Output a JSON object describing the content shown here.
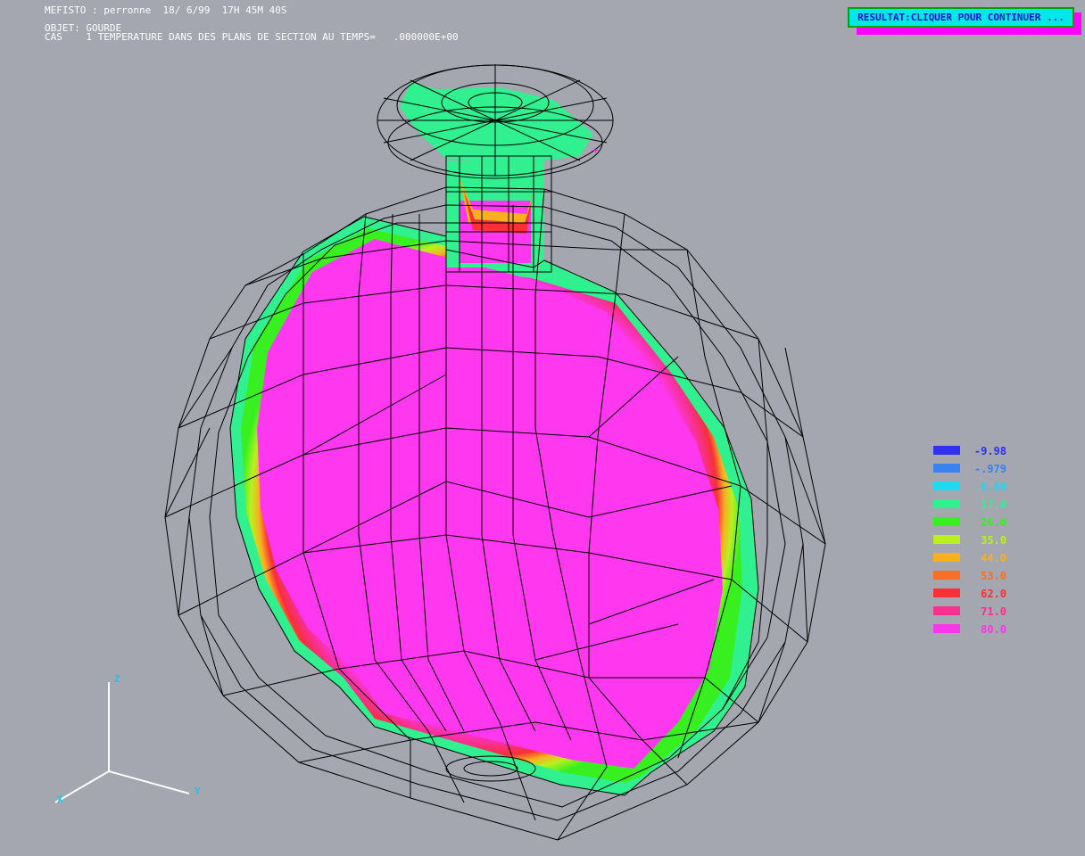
{
  "header": {
    "line1": "MEFISTO : perronne  18/ 6/99  17H 45M 40S",
    "line2": "OBJET: GOURDE",
    "line3": "CAS    1 TEMPERATURE DANS DES PLANS DE SECTION AU TEMPS=   .000000E+00"
  },
  "continue_button": {
    "label": "RESULTAT:CLIQUER POUR CONTINUER ..."
  },
  "legend": [
    {
      "value": "-9.98",
      "color": "#3030f0"
    },
    {
      "value": "-.979",
      "color": "#3a82f0"
    },
    {
      "value": "8.00",
      "color": "#20d8f0"
    },
    {
      "value": "17.0",
      "color": "#30f090"
    },
    {
      "value": "26.0",
      "color": "#38f020"
    },
    {
      "value": "35.0",
      "color": "#b8f020"
    },
    {
      "value": "44.0",
      "color": "#f8b020"
    },
    {
      "value": "53.0",
      "color": "#f87028"
    },
    {
      "value": "62.0",
      "color": "#f83038"
    },
    {
      "value": "71.0",
      "color": "#f83090"
    },
    {
      "value": "80.0",
      "color": "#f838e8"
    }
  ],
  "axes": {
    "z": "Z",
    "x": "X",
    "y": "Y"
  },
  "colors": {
    "background": "#a4a6b0",
    "hot": "#ff38f0",
    "mesh": "#000000"
  },
  "marker": "C"
}
